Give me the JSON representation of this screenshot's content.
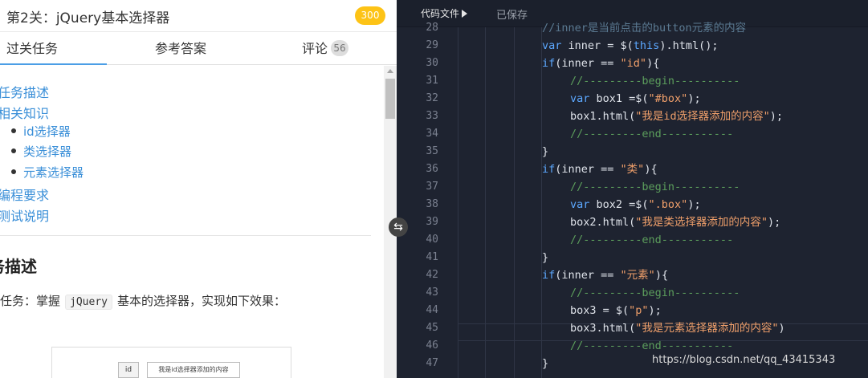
{
  "header": {
    "title": "第2关：jQuery基本选择器",
    "score": "300"
  },
  "tabs": {
    "task": "过关任务",
    "answer": "参考答案",
    "comment": "评论",
    "comment_count": "56"
  },
  "toc": {
    "items": [
      "任务描述",
      "相关知识"
    ],
    "sub_items": [
      "id选择器",
      "类选择器",
      "元素选择器"
    ],
    "items_after": [
      "编程要求",
      "测试说明"
    ]
  },
  "section": {
    "heading": "务描述",
    "task_prefix": "任务：掌握",
    "task_code": "jQuery",
    "task_suffix": "基本的选择器，实现如下效果："
  },
  "preview": {
    "button_label": "id",
    "box_text": "我是id选择器添加的内容"
  },
  "editor": {
    "file_tab": "代码文件",
    "saved_status": "已保存"
  },
  "code_lines": [
    {
      "n": "28",
      "indent": 3,
      "tokens": [
        {
          "c": "cg",
          "t": "//inner是当前点击的button元素的内容"
        }
      ]
    },
    {
      "n": "29",
      "indent": 3,
      "tokens": [
        {
          "c": "k",
          "t": "var"
        },
        {
          "c": "t",
          "t": " inner = $("
        },
        {
          "c": "k",
          "t": "this"
        },
        {
          "c": "t",
          "t": ").html();"
        }
      ]
    },
    {
      "n": "30",
      "indent": 3,
      "tokens": [
        {
          "c": "k",
          "t": "if"
        },
        {
          "c": "t",
          "t": "(inner == "
        },
        {
          "c": "s",
          "t": "\"id\""
        },
        {
          "c": "t",
          "t": "){"
        }
      ]
    },
    {
      "n": "31",
      "indent": 4,
      "tokens": [
        {
          "c": "c",
          "t": "//---------begin----------"
        }
      ]
    },
    {
      "n": "32",
      "indent": 4,
      "tokens": [
        {
          "c": "k",
          "t": "var"
        },
        {
          "c": "t",
          "t": " box1 =$("
        },
        {
          "c": "s",
          "t": "\"#box\""
        },
        {
          "c": "t",
          "t": ");"
        }
      ]
    },
    {
      "n": "33",
      "indent": 4,
      "tokens": [
        {
          "c": "t",
          "t": "box1.html("
        },
        {
          "c": "s",
          "t": "\"我是id选择器添加的内容\""
        },
        {
          "c": "t",
          "t": ");"
        }
      ]
    },
    {
      "n": "34",
      "indent": 4,
      "tokens": [
        {
          "c": "c",
          "t": "//---------end-----------"
        }
      ]
    },
    {
      "n": "35",
      "indent": 3,
      "tokens": [
        {
          "c": "t",
          "t": "}"
        }
      ]
    },
    {
      "n": "36",
      "indent": 3,
      "tokens": [
        {
          "c": "k",
          "t": "if"
        },
        {
          "c": "t",
          "t": "(inner == "
        },
        {
          "c": "s",
          "t": "\"类\""
        },
        {
          "c": "t",
          "t": "){"
        }
      ]
    },
    {
      "n": "37",
      "indent": 4,
      "tokens": [
        {
          "c": "c",
          "t": "//---------begin----------"
        }
      ]
    },
    {
      "n": "38",
      "indent": 4,
      "tokens": [
        {
          "c": "k",
          "t": "var"
        },
        {
          "c": "t",
          "t": " box2 =$("
        },
        {
          "c": "s",
          "t": "\".box\""
        },
        {
          "c": "t",
          "t": ");"
        }
      ]
    },
    {
      "n": "39",
      "indent": 4,
      "tokens": [
        {
          "c": "t",
          "t": "box2.html("
        },
        {
          "c": "s",
          "t": "\"我是类选择器添加的内容\""
        },
        {
          "c": "t",
          "t": ");"
        }
      ]
    },
    {
      "n": "40",
      "indent": 4,
      "tokens": [
        {
          "c": "c",
          "t": "//---------end-----------"
        }
      ]
    },
    {
      "n": "41",
      "indent": 3,
      "tokens": [
        {
          "c": "t",
          "t": "}"
        }
      ]
    },
    {
      "n": "42",
      "indent": 3,
      "tokens": [
        {
          "c": "k",
          "t": "if"
        },
        {
          "c": "t",
          "t": "(inner == "
        },
        {
          "c": "s",
          "t": "\"元素\""
        },
        {
          "c": "t",
          "t": "){"
        }
      ]
    },
    {
      "n": "43",
      "indent": 4,
      "tokens": [
        {
          "c": "c",
          "t": "//---------begin----------"
        }
      ]
    },
    {
      "n": "44",
      "indent": 4,
      "tokens": [
        {
          "c": "t",
          "t": "box3 = $("
        },
        {
          "c": "s",
          "t": "\"p\""
        },
        {
          "c": "t",
          "t": ");"
        }
      ]
    },
    {
      "n": "45",
      "indent": 4,
      "tokens": [
        {
          "c": "t",
          "t": "box3.html("
        },
        {
          "c": "s",
          "t": "\"我是元素选择器添加的内容\""
        },
        {
          "c": "t",
          "t": ")"
        }
      ]
    },
    {
      "n": "46",
      "indent": 4,
      "tokens": [
        {
          "c": "c",
          "t": "//---------end-----------"
        }
      ]
    },
    {
      "n": "47",
      "indent": 3,
      "tokens": [
        {
          "c": "t",
          "t": "}"
        }
      ]
    }
  ],
  "watermark": "https://blog.csdn.net/qq_43415343",
  "colors": {
    "score_badge": "#fdc316",
    "active_tab_underline": "#4b9ee6",
    "link": "#3a8fd8",
    "editor_bg": "#1e2330",
    "keyword": "#5ca8ff",
    "string": "#ef9f6a",
    "comment": "#5c9e5c"
  },
  "icons": {
    "swap": "swap-horizontal-icon",
    "file_tab_arrow": "triangle-right-icon"
  }
}
